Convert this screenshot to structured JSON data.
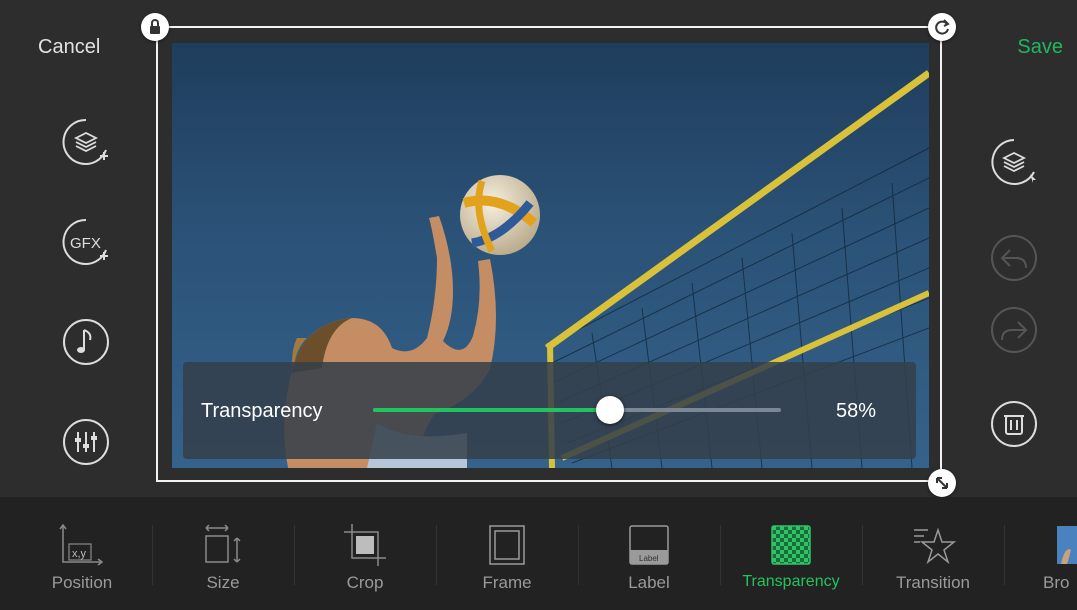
{
  "header": {
    "cancel_label": "Cancel",
    "save_label": "Save"
  },
  "colors": {
    "accent": "#22c35e",
    "save": "#1fb860",
    "background": "#2d2d2d",
    "toolbar": "#222222"
  },
  "left_tools": [
    {
      "icon": "add-layer-icon"
    },
    {
      "icon": "add-gfx-icon",
      "text": "GFX"
    },
    {
      "icon": "music-note-icon"
    },
    {
      "icon": "equalizer-icon"
    }
  ],
  "right_tools": [
    {
      "icon": "select-layer-icon",
      "enabled": true
    },
    {
      "icon": "undo-icon",
      "enabled": false
    },
    {
      "icon": "redo-icon",
      "enabled": false
    },
    {
      "icon": "delete-icon",
      "enabled": true
    }
  ],
  "transparency": {
    "label": "Transparency",
    "value": 58,
    "value_text": "58%"
  },
  "toolbar": {
    "items": [
      {
        "label": "Position",
        "icon": "position-icon",
        "icon_text": "x,y"
      },
      {
        "label": "Size",
        "icon": "size-icon"
      },
      {
        "label": "Crop",
        "icon": "crop-icon"
      },
      {
        "label": "Frame",
        "icon": "frame-icon"
      },
      {
        "label": "Label",
        "icon": "label-icon",
        "icon_text": "Label"
      },
      {
        "label": "Transparency",
        "icon": "transparency-icon",
        "active": true
      },
      {
        "label": "Transition",
        "icon": "transition-icon"
      },
      {
        "label": "Bro",
        "icon": "browse-icon"
      }
    ]
  }
}
